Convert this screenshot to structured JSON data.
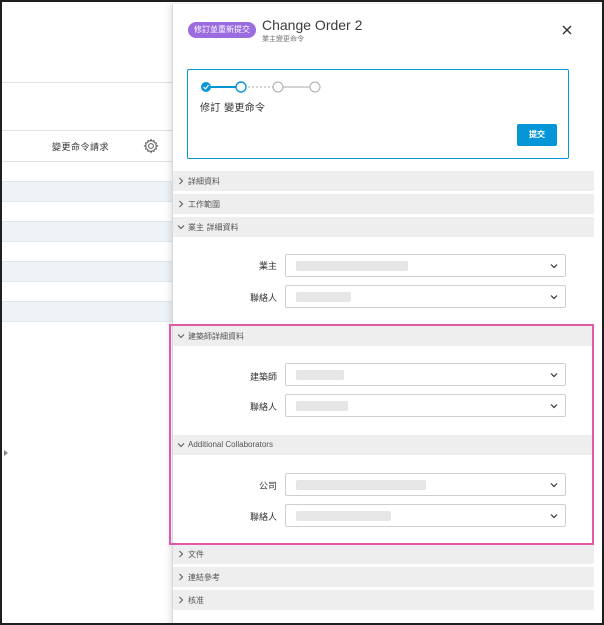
{
  "background": {
    "column_header": "變更命令請求",
    "icons": {
      "settings": "gear-icon"
    },
    "row_count": 8
  },
  "drawer": {
    "badge": "修訂並重新提交",
    "title": "Change Order 2",
    "subtitle": "業主變更命令",
    "status": {
      "text": "修訂 變更命令",
      "submit_label": "提交",
      "steps_completed": 1,
      "steps_total": 4
    },
    "sections": {
      "details": "詳細資料",
      "scope": "工作範圍",
      "owner_details": "業主 詳細資料",
      "architect_details": "建築師詳細資料",
      "additional_collaborators": "Additional Collaborators",
      "files": "文件",
      "references": "連結參考",
      "approval": "核准"
    },
    "fields": {
      "owner": "業主",
      "owner_contact": "聯絡人",
      "architect": "建築師",
      "architect_contact": "聯絡人",
      "company": "公司",
      "company_contact": "聯絡人"
    },
    "colors": {
      "badge": "#9b6be0",
      "accent": "#0696d7",
      "highlight": "#e05aa6"
    }
  }
}
